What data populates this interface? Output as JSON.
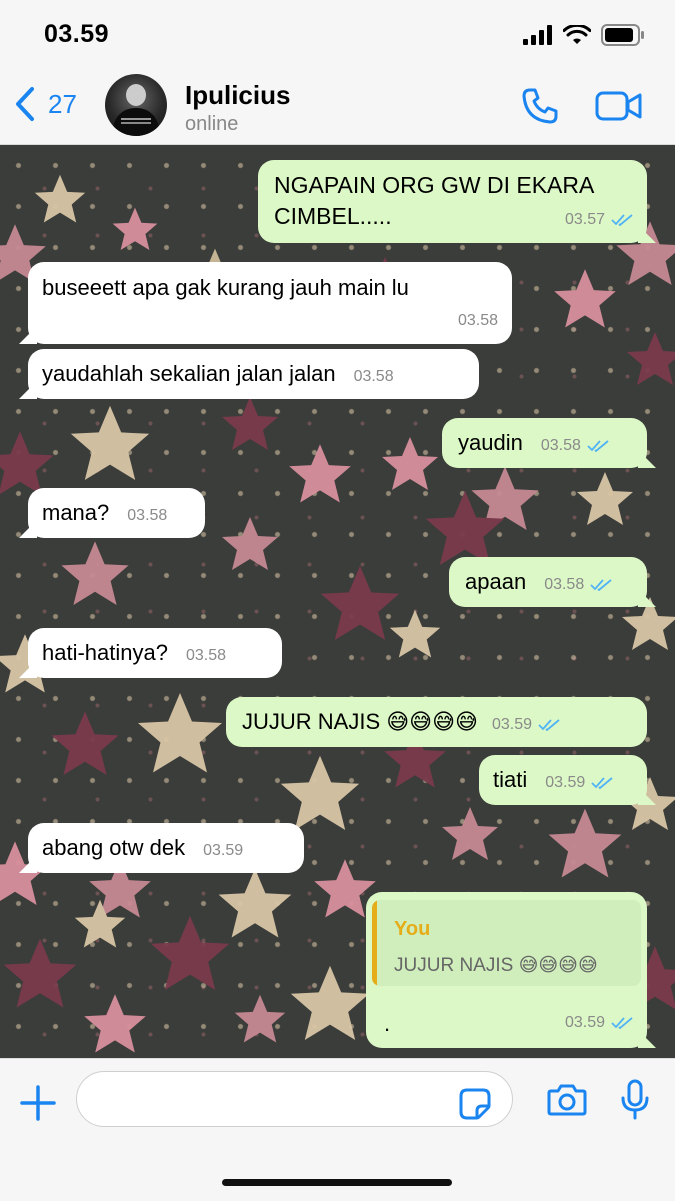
{
  "status_bar": {
    "time": "03.59"
  },
  "header": {
    "back_count": "27",
    "contact_name": "Ipulicius",
    "contact_status": "online"
  },
  "messages": [
    {
      "dir": "out",
      "text": "NGAPAIN ORG GW DI EKARA CIMBEL.....",
      "time": "03.57",
      "read": true
    },
    {
      "dir": "in",
      "text": "buseeett apa gak kurang jauh main lu",
      "time": "03.58"
    },
    {
      "dir": "in",
      "text": "yaudahlah sekalian jalan jalan",
      "time": "03.58"
    },
    {
      "dir": "out",
      "text": "yaudin",
      "time": "03.58",
      "read": true
    },
    {
      "dir": "in",
      "text": "mana?",
      "time": "03.58"
    },
    {
      "dir": "out",
      "text": "apaan",
      "time": "03.58",
      "read": true
    },
    {
      "dir": "in",
      "text": "hati-hatinya?",
      "time": "03.58"
    },
    {
      "dir": "out",
      "text": "JUJUR NAJIS 😅😅😅😅",
      "time": "03.59",
      "read": true
    },
    {
      "dir": "out",
      "text": "tiati",
      "time": "03.59",
      "read": true
    },
    {
      "dir": "in",
      "text": "abang otw dek",
      "time": "03.59"
    },
    {
      "dir": "out",
      "text": ".",
      "time": "03.59",
      "read": true,
      "reply": {
        "author": "You",
        "text": "JUJUR NAJIS 😅😅😅😅"
      }
    }
  ],
  "colors": {
    "accent": "#1a84f0",
    "outgoing_bubble": "#dcf8c6",
    "incoming_bubble": "#ffffff",
    "read_ticks": "#4fb3f5",
    "reply_author": "#e6ad1a",
    "wallpaper": "#3b3d3a"
  },
  "icons": {
    "back": "chevron-left-icon",
    "call": "phone-icon",
    "video": "video-camera-icon",
    "attach": "plus-icon",
    "sticker": "sticker-icon",
    "camera": "camera-icon",
    "mic": "microphone-icon"
  }
}
